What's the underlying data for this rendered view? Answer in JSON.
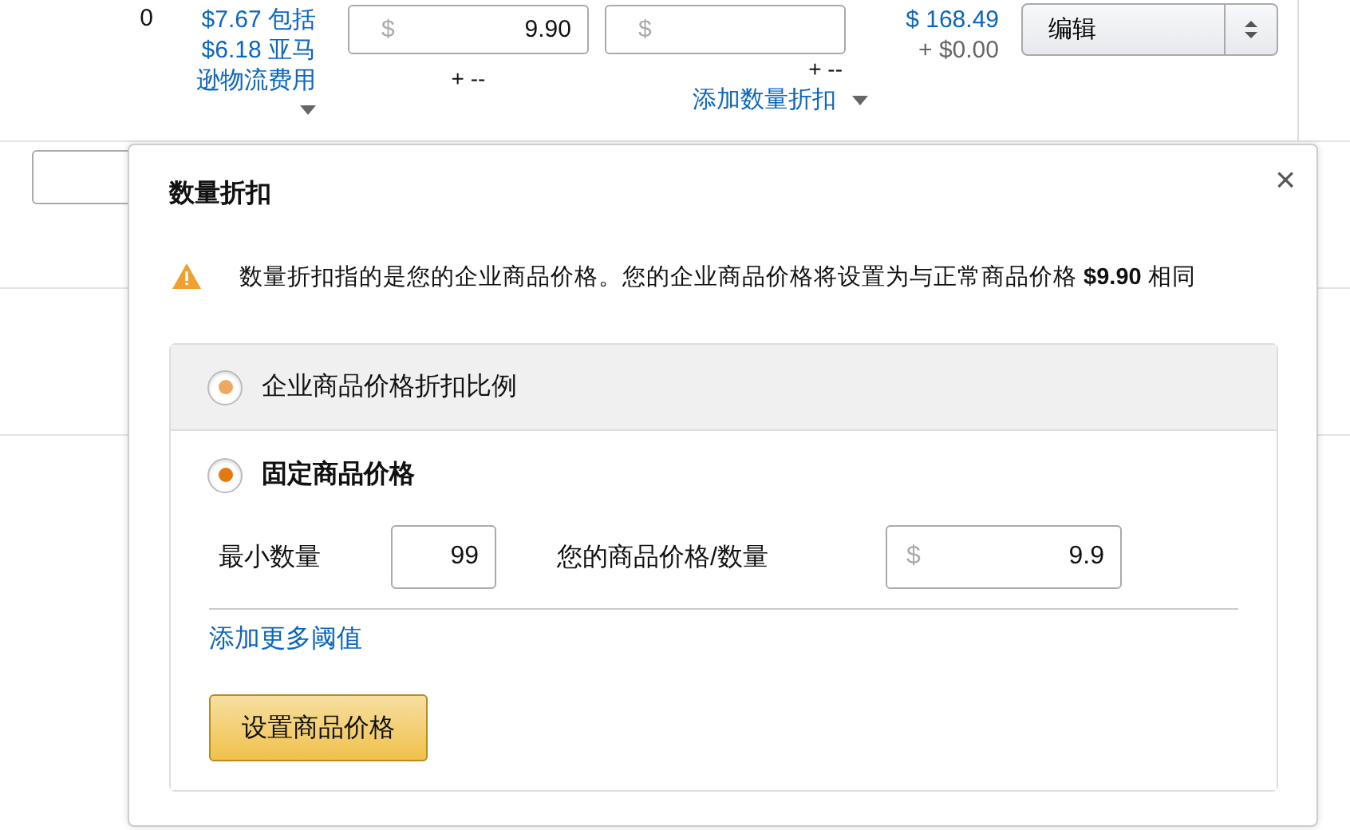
{
  "rows": [
    {
      "col_2": "0",
      "shipping_link": "$7.67 包括 $6.18 亚马逊物流费用",
      "price": {
        "prefix": "$",
        "value": "9.90",
        "adjust": "+ --"
      },
      "business_price": {
        "prefix": "$",
        "adjust": "+ --",
        "discount_link": "添加数量折扣"
      },
      "total": "$ 168.49",
      "total_extra": "+ $0.00",
      "action": "编辑"
    },
    {
      "has_field": true
    },
    {
      "has_field": false
    }
  ],
  "popover": {
    "title": "数量折扣",
    "close": "×",
    "warning": "数量折扣指的是您的企业商品价格。您的企业商品价格将设置为与正常商品价格 **$9.90** 相同",
    "options": [
      {
        "label": "企业商品价格折扣比例",
        "selected": false,
        "hovered": true
      },
      {
        "label": "固定商品价格",
        "selected": true,
        "hovered": false
      }
    ],
    "tier": {
      "min_qty_label": "最小数量",
      "min_qty": "99",
      "price_label": "您的商品价格/数量",
      "price_prefix": "$",
      "price": "9.9"
    },
    "add_link": "添加更多阈值",
    "submit": "设置商品价格"
  }
}
